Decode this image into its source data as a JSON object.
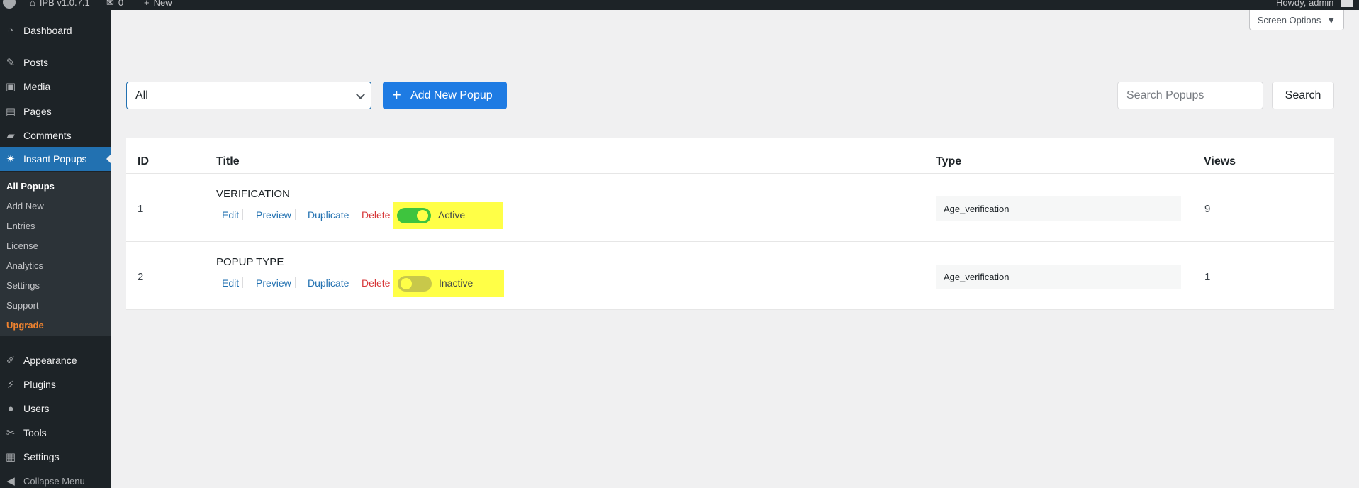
{
  "adminbar": {
    "site_name": "IPB v1.0.7.1",
    "comments_count": "0",
    "new_label": "New",
    "howdy": "Howdy, admin"
  },
  "sidebar": {
    "items": [
      {
        "label": "Dashboard",
        "icon": "dashboard-icon"
      },
      {
        "label": "Posts",
        "icon": "pin-icon"
      },
      {
        "label": "Media",
        "icon": "media-icon"
      },
      {
        "label": "Pages",
        "icon": "pages-icon"
      },
      {
        "label": "Comments",
        "icon": "comment-icon"
      },
      {
        "label": "Insant Popups",
        "icon": "popup-icon"
      },
      {
        "label": "Appearance",
        "icon": "brush-icon"
      },
      {
        "label": "Plugins",
        "icon": "plugin-icon"
      },
      {
        "label": "Users",
        "icon": "user-icon"
      },
      {
        "label": "Tools",
        "icon": "wrench-icon"
      },
      {
        "label": "Settings",
        "icon": "settings-icon"
      }
    ],
    "submenu": [
      "All Popups",
      "Add New",
      "Entries",
      "License",
      "Analytics",
      "Settings",
      "Support",
      "Upgrade"
    ],
    "collapse_label": "Collapse Menu"
  },
  "screen_options": "Screen Options",
  "toolbar": {
    "filter_value": "All",
    "add_new_label": "Add New Popup",
    "search_placeholder": "Search Popups",
    "search_button": "Search"
  },
  "table": {
    "headers": {
      "id": "ID",
      "title": "Title",
      "type": "Type",
      "views": "Views"
    },
    "actions": {
      "edit": "Edit",
      "preview": "Preview",
      "duplicate": "Duplicate",
      "delete": "Delete"
    },
    "rows": [
      {
        "id": "1",
        "title": "VERIFICATION",
        "status": "Active",
        "type": "Age_verification",
        "views": "9"
      },
      {
        "id": "2",
        "title": "POPUP TYPE",
        "status": "Inactive",
        "type": "Age_verification",
        "views": "1"
      }
    ]
  },
  "colors": {
    "sidebar_bg": "#1d2327",
    "accent": "#2271b1",
    "primary_button": "#1e7be3",
    "toggle_on": "#3ec43e",
    "highlight": "#ffff47",
    "delete": "#d63638",
    "upgrade": "#f0832f"
  }
}
